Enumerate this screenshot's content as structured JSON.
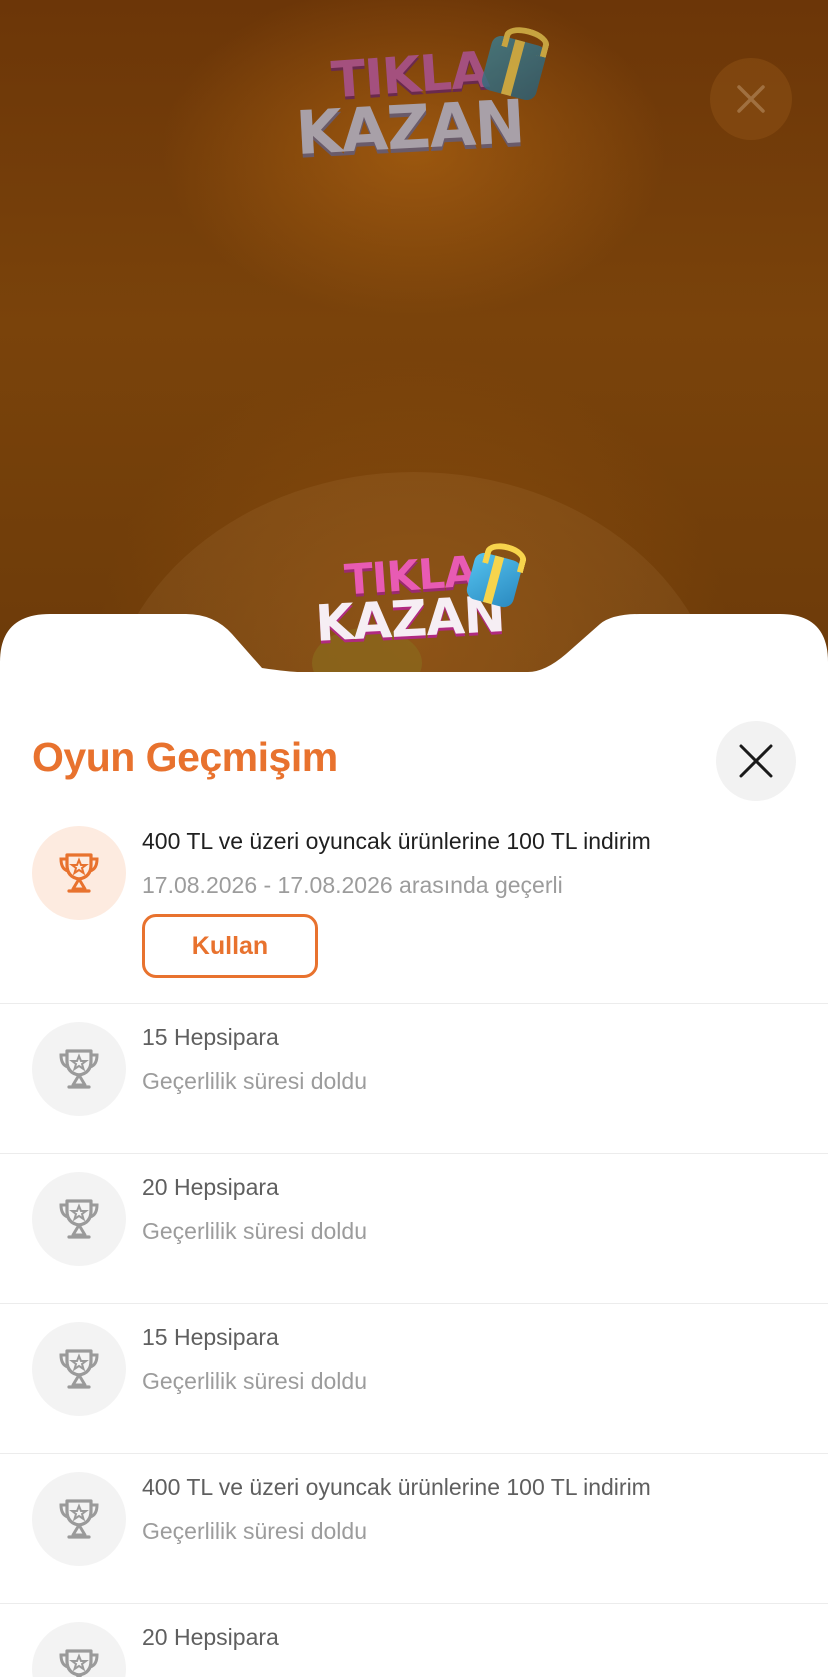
{
  "game": {
    "logo_top_line1": "TIKLA",
    "logo_top_line2": "KAZAN",
    "logo_bottom_line1": "TIKLA",
    "logo_bottom_line2": "KAZAN"
  },
  "sheet": {
    "title": "Oyun Geçmişim",
    "use_button_label": "Kullan"
  },
  "history": [
    {
      "title": "400 TL ve üzeri oyuncak ürünlerine 100 TL indirim",
      "subtitle": "17.08.2026 - 17.08.2026 arasında geçerli",
      "active": true
    },
    {
      "title": "15 Hepsipara",
      "subtitle": "Geçerlilik süresi doldu",
      "active": false
    },
    {
      "title": "20 Hepsipara",
      "subtitle": "Geçerlilik süresi doldu",
      "active": false
    },
    {
      "title": "15 Hepsipara",
      "subtitle": "Geçerlilik süresi doldu",
      "active": false
    },
    {
      "title": "400 TL ve üzeri oyuncak ürünlerine 100 TL indirim",
      "subtitle": "Geçerlilik süresi doldu",
      "active": false
    },
    {
      "title": "20 Hepsipara",
      "subtitle": "",
      "active": false
    }
  ],
  "colors": {
    "accent": "#e8722e",
    "background": "#6e3a09",
    "muted_text": "#9c9c9c"
  },
  "icons": {
    "reward": "trophy-icon",
    "close": "close-icon"
  }
}
